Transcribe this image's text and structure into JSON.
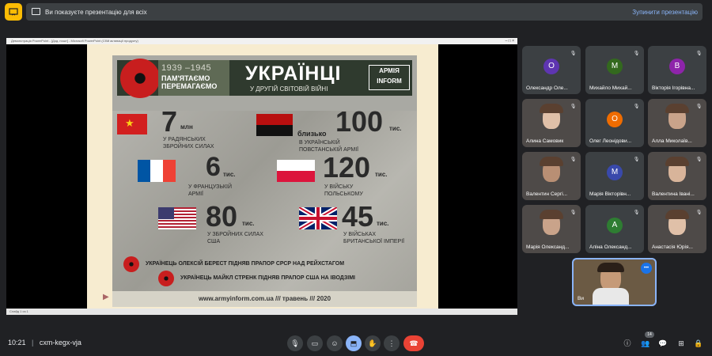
{
  "top": {
    "presenting_text": "Ви показуєте презентацію для всіх",
    "stop_button": "Зупинити презентацію"
  },
  "ppt": {
    "window_title": "Демонстрація PowerPoint - [Дод. пошт] - Microsoft PowerPoint (Сбій активації продукту)",
    "window_controls": "– □ ×",
    "status": "Слайд 1 из 1"
  },
  "slide": {
    "years": "1939 –1945",
    "remember1": "ПАМ'ЯТАЄМО",
    "remember2": "ПЕРЕМАГАЄМО",
    "title": "УКРАЇНЦІ",
    "subtitle": "У ДРУГІЙ СВІТОВІЙ ВІЙНІ",
    "logo_line1": "АРМІЯ",
    "logo_line2": "INFORM",
    "stats": [
      {
        "number": "7",
        "unit": "млн",
        "desc1": "у радянських",
        "desc2": "збройних силах",
        "prefix": ""
      },
      {
        "number": "100",
        "unit": "тис.",
        "desc1": "в українській",
        "desc2": "повстанській армії",
        "prefix": "близько"
      },
      {
        "number": "6",
        "unit": "тис.",
        "desc1": "у французькій",
        "desc2": "армії",
        "prefix": ""
      },
      {
        "number": "120",
        "unit": "тис.",
        "desc1": "у війську",
        "desc2": "польському",
        "prefix": ""
      },
      {
        "number": "80",
        "unit": "тис.",
        "desc1": "у збройних силах",
        "desc2": "США",
        "prefix": ""
      },
      {
        "number": "45",
        "unit": "тис.",
        "desc1": "у військах",
        "desc2": "британської імперії",
        "prefix": ""
      }
    ],
    "note1": "УКРАЇНЕЦЬ ОЛЕКСІЙ БЕРЕСТ ПІДНЯВ ПРАПОР СРСР НАД РЕЙХСТАГОМ",
    "note2": "УКРАЇНЕЦЬ МАЙКЛ СТРЕНК ПІДНЯВ ПРАПОР США НА ІВОДЗІМІ",
    "footer": "www.armyinform.com.ua  ///  травень  ///  2020"
  },
  "participants": [
    {
      "initial": "О",
      "name": "Олександр Оле...",
      "color": "#5e35b1",
      "video": false
    },
    {
      "initial": "М",
      "name": "Михайло Михай...",
      "color": "#33691e",
      "video": false
    },
    {
      "initial": "В",
      "name": "Вікторія Ігорівна...",
      "color": "#8e24aa",
      "video": false
    },
    {
      "initial": "",
      "name": "Алина Самовик",
      "color": "",
      "video": true
    },
    {
      "initial": "О",
      "name": "Олег Леонідови...",
      "color": "#ef6c00",
      "video": false
    },
    {
      "initial": "",
      "name": "Алла Миколаїв...",
      "color": "",
      "video": true
    },
    {
      "initial": "",
      "name": "Валентин Сергі...",
      "color": "",
      "video": true
    },
    {
      "initial": "М",
      "name": "Марія Вікторівн...",
      "color": "#3949ab",
      "video": false
    },
    {
      "initial": "",
      "name": "Валентина Івані...",
      "color": "",
      "video": true
    },
    {
      "initial": "",
      "name": "Марія Олександ...",
      "color": "",
      "video": true
    },
    {
      "initial": "А",
      "name": "Аліна Олександ...",
      "color": "#2e7d32",
      "video": false
    },
    {
      "initial": "",
      "name": "Анастасія Юрія...",
      "color": "",
      "video": true
    }
  ],
  "self_tile": {
    "label": "Ви",
    "more": "•••"
  },
  "bottom": {
    "time": "10:21",
    "separator": "|",
    "meeting_code": "cxm-kegx-vja",
    "people_count": "14"
  }
}
